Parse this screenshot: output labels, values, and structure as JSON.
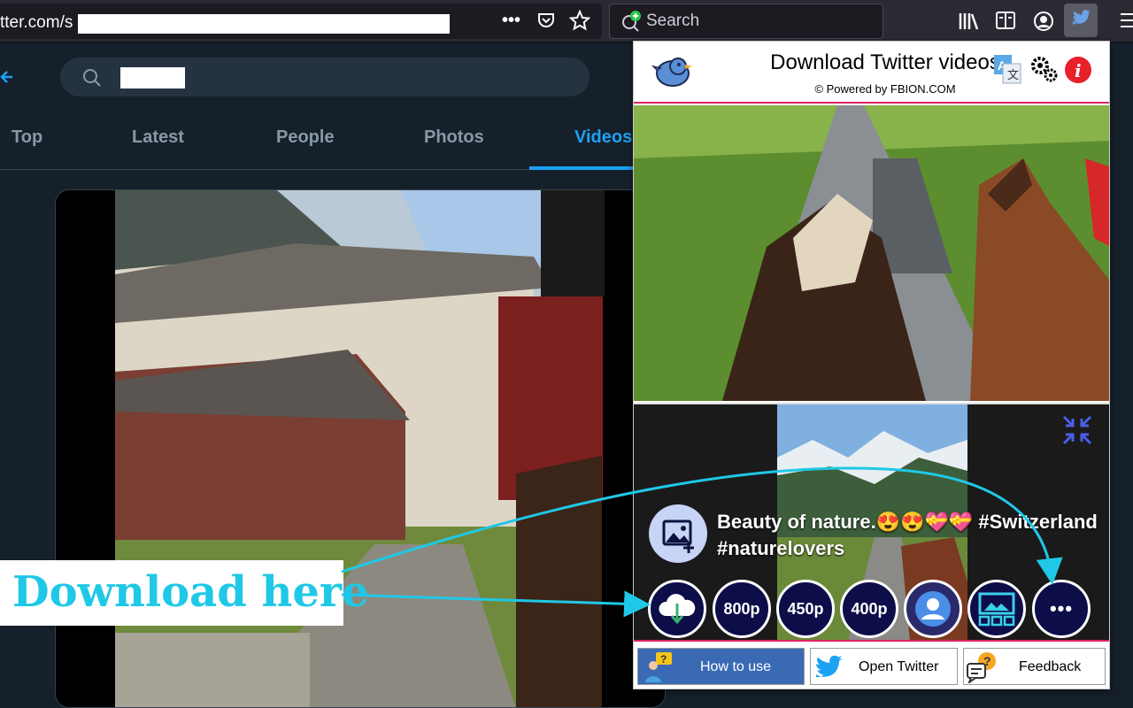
{
  "browser": {
    "url_visible": "tter.com/s",
    "search_placeholder": "Search",
    "icons": [
      "more-dots-icon",
      "pocket-icon",
      "bookmark-star-icon",
      "library-icon",
      "reader-icon",
      "account-icon",
      "extension-twitter-icon",
      "menu-icon"
    ]
  },
  "twitter": {
    "tabs": [
      "Top",
      "Latest",
      "People",
      "Photos",
      "Videos"
    ],
    "active_tab": "Videos",
    "accent": "#1da1f2"
  },
  "popup": {
    "title": "Download Twitter videos",
    "subtitle": "© Powered by FBION.COM",
    "caption": "Beauty of nature.😍😍💝💝 #Switzerland #naturelovers",
    "buttons": {
      "q1": "800p",
      "q2": "450p",
      "q3": "400p",
      "more": "•••"
    },
    "footer": {
      "how_to_use": "How to use",
      "open_twitter": "Open Twitter",
      "feedback": "Feedback"
    },
    "colors": {
      "dark_button": "#0d0d4a",
      "accent_red": "#e0245e",
      "how_to_bg": "#3b6ab5"
    }
  },
  "annotation": {
    "text": "Download here",
    "color": "#1fc8e6"
  }
}
